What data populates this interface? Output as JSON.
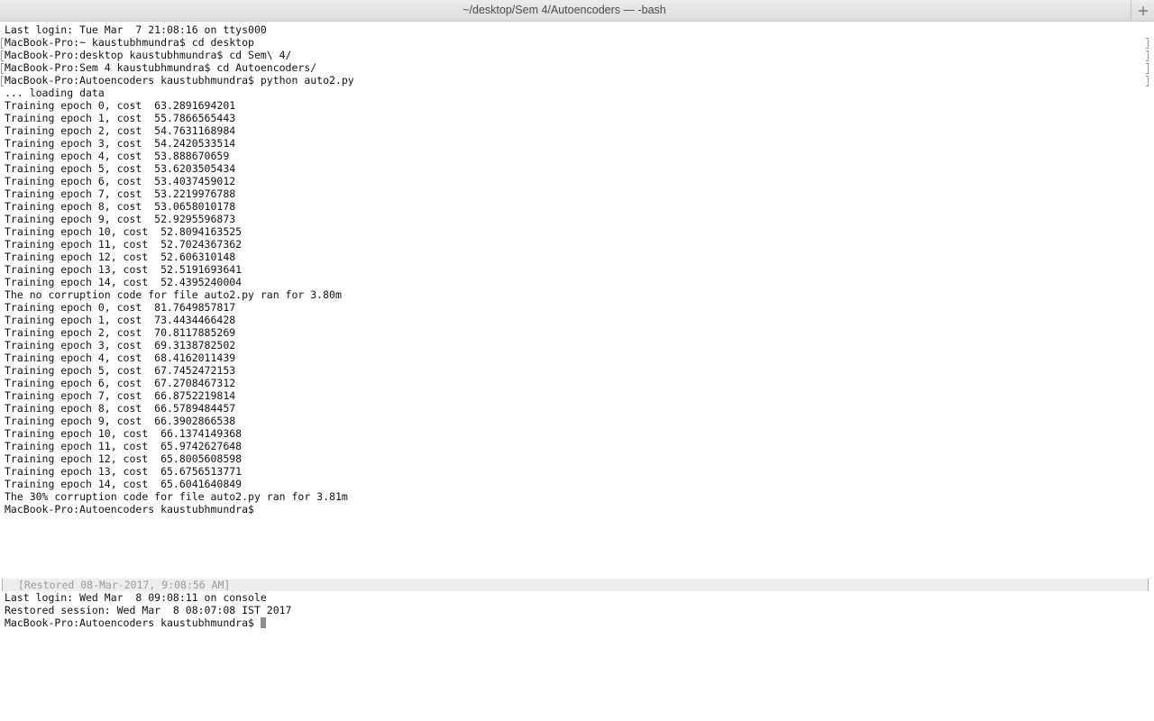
{
  "window": {
    "title": "~/desktop/Sem 4/Autoencoders — -bash",
    "new_tab_icon": "plus-icon"
  },
  "session1": {
    "last_login": "Last login: Tue Mar  7 21:08:16 on ttys000",
    "commands": [
      "MacBook-Pro:~ kaustubhmundra$ cd desktop",
      "MacBook-Pro:desktop kaustubhmundra$ cd Sem\\ 4/",
      "MacBook-Pro:Sem 4 kaustubhmundra$ cd Autoencoders/",
      "MacBook-Pro:Autoencoders kaustubhmundra$ python auto2.py"
    ],
    "loading": "... loading data",
    "run1": [
      "Training epoch 0, cost  63.2891694201",
      "Training epoch 1, cost  55.7866565443",
      "Training epoch 2, cost  54.7631168984",
      "Training epoch 3, cost  54.2420533514",
      "Training epoch 4, cost  53.888670659",
      "Training epoch 5, cost  53.6203505434",
      "Training epoch 6, cost  53.4037459012",
      "Training epoch 7, cost  53.2219976788",
      "Training epoch 8, cost  53.0658010178",
      "Training epoch 9, cost  52.9295596873",
      "Training epoch 10, cost  52.8094163525",
      "Training epoch 11, cost  52.7024367362",
      "Training epoch 12, cost  52.606310148",
      "Training epoch 13, cost  52.5191693641",
      "Training epoch 14, cost  52.4395240004"
    ],
    "run1_summary": "The no corruption code for file auto2.py ran for 3.80m",
    "run2": [
      "Training epoch 0, cost  81.7649857817",
      "Training epoch 1, cost  73.4434466428",
      "Training epoch 2, cost  70.8117885269",
      "Training epoch 3, cost  69.3138782502",
      "Training epoch 4, cost  68.4162011439",
      "Training epoch 5, cost  67.7452472153",
      "Training epoch 6, cost  67.2708467312",
      "Training epoch 7, cost  66.8752219814",
      "Training epoch 8, cost  66.5789484457",
      "Training epoch 9, cost  66.3902866538",
      "Training epoch 10, cost  66.1374149368",
      "Training epoch 11, cost  65.9742627648",
      "Training epoch 12, cost  65.8005608598",
      "Training epoch 13, cost  65.6756513771",
      "Training epoch 14, cost  65.6041640849"
    ],
    "run2_summary": "The 30% corruption code for file auto2.py ran for 3.81m",
    "final_prompt": "MacBook-Pro:Autoencoders kaustubhmundra$"
  },
  "restored_marker": "[Restored 08-Mar-2017, 9:08:56 AM]",
  "session2": {
    "last_login": "Last login: Wed Mar  8 09:08:11 on console",
    "restored_session": "Restored session: Wed Mar  8 08:07:08 IST 2017",
    "prompt": "MacBook-Pro:Autoencoders kaustubhmundra$"
  }
}
